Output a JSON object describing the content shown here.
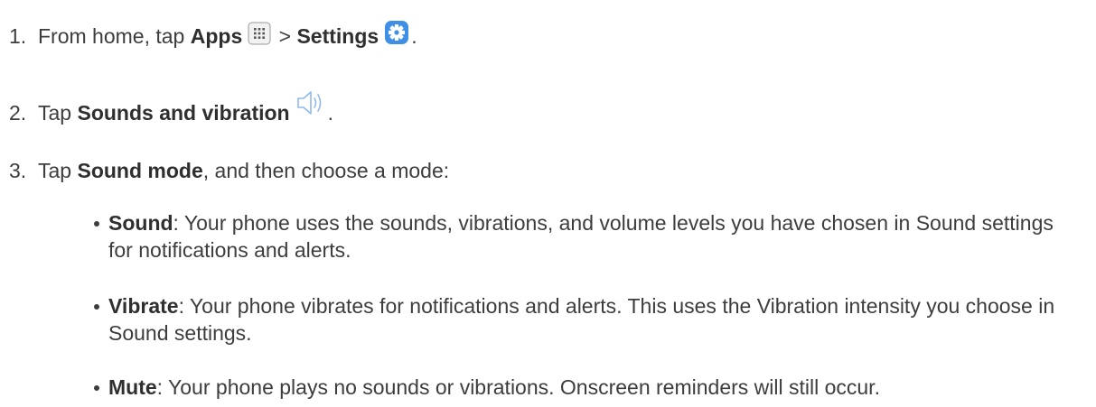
{
  "steps": [
    {
      "number": "1.",
      "pre": "From home, tap ",
      "bold1": "Apps",
      "sep": " > ",
      "bold2": "Settings",
      "post": "."
    },
    {
      "number": "2.",
      "pre": "Tap ",
      "bold1": "Sounds and vibration",
      "post": "."
    },
    {
      "number": "3.",
      "pre": "Tap ",
      "bold1": "Sound mode",
      "post": ", and then choose a mode:"
    }
  ],
  "modes": [
    {
      "name": "Sound",
      "desc": ": Your phone uses the sounds, vibrations, and volume levels you have chosen in Sound settings for notifications and alerts."
    },
    {
      "name": "Vibrate",
      "desc": ": Your phone vibrates for notifications and alerts. This uses the Vibration intensity you choose in Sound settings."
    },
    {
      "name": "Mute",
      "desc": ": Your phone plays no sounds or vibrations. Onscreen reminders will still occur."
    }
  ],
  "icons": {
    "apps": "apps-grid-icon",
    "settings": "settings-gear-icon",
    "sound": "speaker-icon"
  },
  "colors": {
    "text": "#3d3d3d",
    "settings_icon": "#3f8fe6",
    "speaker_icon": "#8fb8ee"
  }
}
